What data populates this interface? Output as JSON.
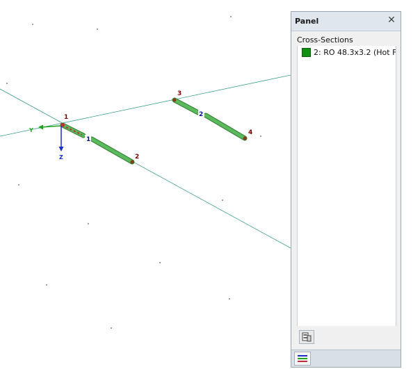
{
  "viewport": {
    "nodes": [
      {
        "id": "1"
      },
      {
        "id": "2"
      },
      {
        "id": "3"
      },
      {
        "id": "4"
      }
    ],
    "members": [
      {
        "id": "1"
      },
      {
        "id": "2"
      }
    ],
    "axes": {
      "y_label": "Y",
      "z_label": "Z"
    }
  },
  "panel": {
    "title": "Panel",
    "close_icon": "close-icon",
    "section_header": "Cross-Sections",
    "items": [
      {
        "label": "2: RO 48.3x3.2 (Hot For",
        "color": "#109010"
      }
    ],
    "toolbar_icon": "panel-settings-icon",
    "bottom_tab_icon": "color-lines-icon"
  },
  "colors": {
    "member": "#5cb85c",
    "member_dark": "#2e7d2e",
    "grid_line": "#3f9e8e",
    "node_label": "#7a0000",
    "member_label": "#000f8c",
    "axis_y": "#1fa31f",
    "axis_z": "#1a2ecc"
  }
}
